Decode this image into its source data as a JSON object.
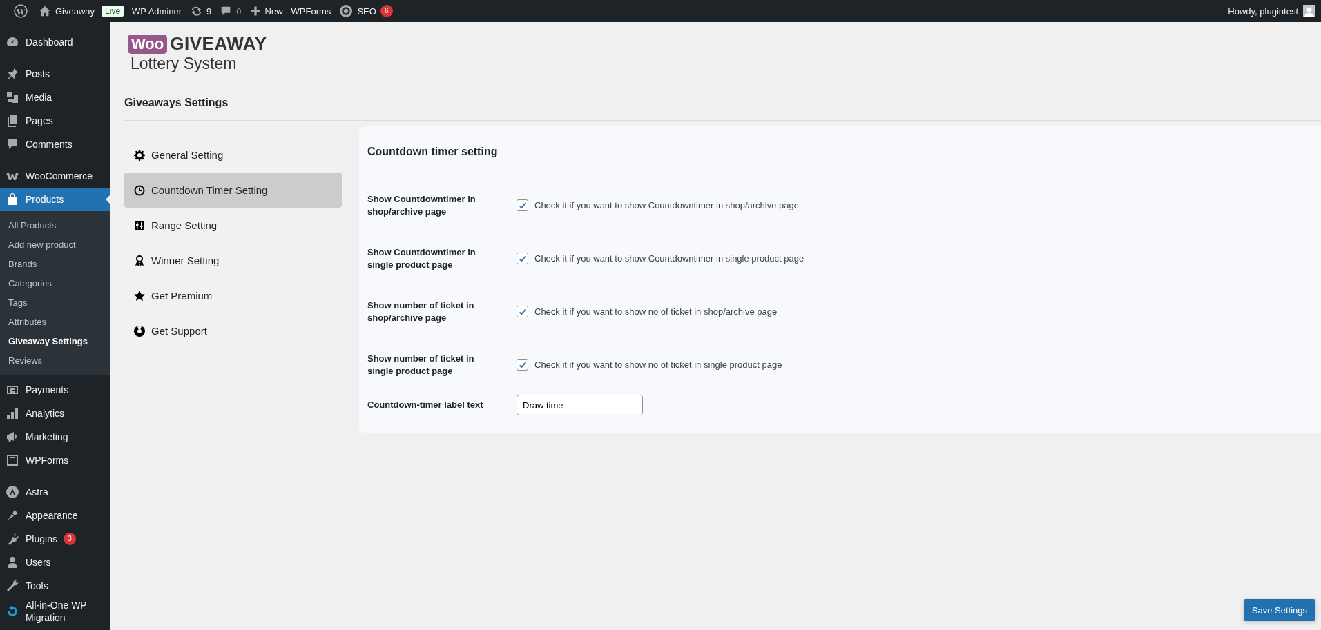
{
  "admin_bar": {
    "site": "Giveaway",
    "live_badge": "Live",
    "adminer": "WP Adminer",
    "updates": "9",
    "comments": "0",
    "new": "New",
    "wpforms": "WPForms",
    "seo": "SEO",
    "seo_badge": "6",
    "greeting": "Howdy, plugintest"
  },
  "sidebar": {
    "groups": [
      [
        {
          "label": "Dashboard",
          "selected": false
        }
      ],
      [
        {
          "label": "Posts",
          "selected": false
        },
        {
          "label": "Media",
          "selected": false
        },
        {
          "label": "Pages",
          "selected": false
        },
        {
          "label": "Comments",
          "selected": false
        }
      ],
      [
        {
          "label": "WooCommerce",
          "selected": false
        },
        {
          "label": "Products",
          "selected": true,
          "children": [
            {
              "label": "All Products",
              "selected": false
            },
            {
              "label": "Add new product",
              "selected": false
            },
            {
              "label": "Brands",
              "selected": false
            },
            {
              "label": "Categories",
              "selected": false
            },
            {
              "label": "Tags",
              "selected": false
            },
            {
              "label": "Attributes",
              "selected": false
            },
            {
              "label": "Giveaway Settings",
              "selected": true
            },
            {
              "label": "Reviews",
              "selected": false
            }
          ]
        },
        {
          "label": "Payments",
          "selected": false
        },
        {
          "label": "Analytics",
          "selected": false
        },
        {
          "label": "Marketing",
          "selected": false
        },
        {
          "label": "WPForms",
          "selected": false
        }
      ],
      [
        {
          "label": "Astra",
          "selected": false
        },
        {
          "label": "Appearance",
          "selected": false
        },
        {
          "label": "Plugins",
          "selected": false,
          "badge": "3"
        },
        {
          "label": "Users",
          "selected": false
        },
        {
          "label": "Tools",
          "selected": false
        },
        {
          "label": "All-in-One WP Migration",
          "selected": false
        }
      ]
    ]
  },
  "logo": {
    "brand": "Woo",
    "title": "GIVEAWAY",
    "subtitle": "Lottery System"
  },
  "page_title": "Giveaways Settings",
  "settings_tabs": [
    {
      "label": "General Setting",
      "selected": false
    },
    {
      "label": "Countdown Timer Setting",
      "selected": true
    },
    {
      "label": "Range Setting",
      "selected": false
    },
    {
      "label": "Winner Setting",
      "selected": false
    },
    {
      "label": "Get Premium",
      "selected": false
    },
    {
      "label": "Get Support",
      "selected": false
    }
  ],
  "panel": {
    "title": "Countdown timer setting",
    "rows": [
      {
        "kind": "checkbox",
        "label": "Show Countdowntimer in shop/archive page",
        "checked": true,
        "description": "Check it if you want to show Countdowntimer in shop/archive page"
      },
      {
        "kind": "checkbox",
        "label": "Show Countdowntimer in single product page",
        "checked": true,
        "description": "Check it if you want to show Countdowntimer in single product page"
      },
      {
        "kind": "checkbox",
        "label": "Show number of ticket in shop/archive page",
        "checked": true,
        "description": "Check it if you want to show no of ticket in shop/archive page"
      },
      {
        "kind": "checkbox",
        "label": "Show number of ticket in single product page",
        "checked": true,
        "description": "Check it if you want to show no of ticket in single product page"
      },
      {
        "kind": "text",
        "label": "Countdown-timer label text",
        "value": "Draw time"
      }
    ]
  },
  "save_button": "Save Settings"
}
